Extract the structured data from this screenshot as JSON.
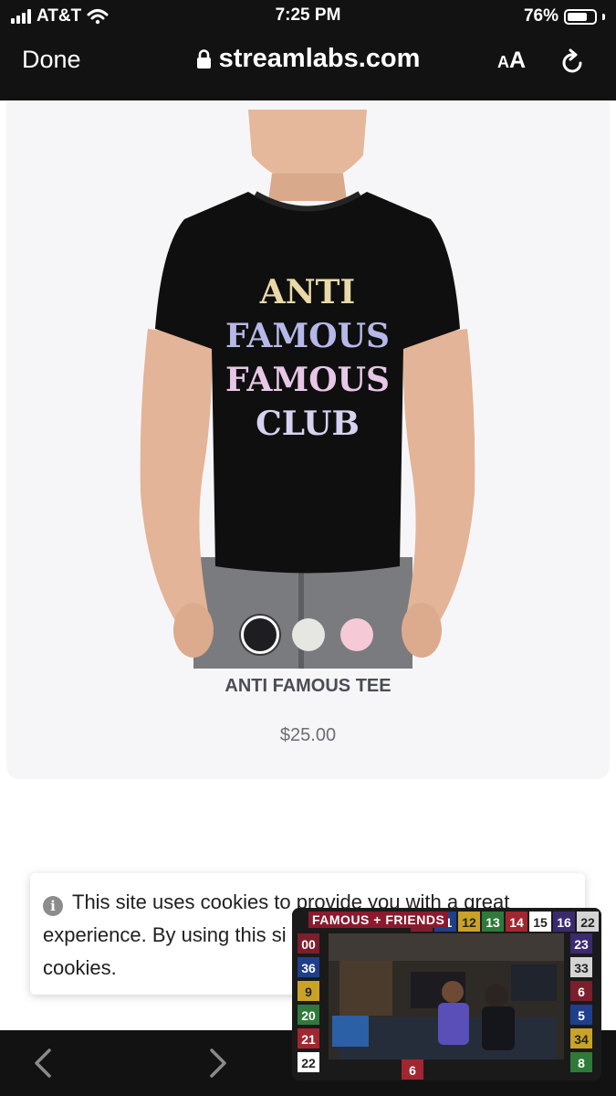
{
  "status_bar": {
    "carrier": "AT&T",
    "time": "7:25 PM",
    "battery": "76%",
    "battery_level": 0.76
  },
  "browser": {
    "done_label": "Done",
    "url": "streamlabs.com",
    "text_size_small": "A",
    "text_size_large": "A"
  },
  "product": {
    "shirt_text": [
      "ANTI",
      "FAMOUS",
      "FAMOUS",
      "CLUB"
    ],
    "title": "ANTI FAMOUS TEE",
    "price": "$25.00",
    "swatches": [
      {
        "color": "#1e1e22",
        "selected": true
      },
      {
        "color": "#e6e6e3",
        "selected": false
      },
      {
        "color": "#f6c9d6",
        "selected": false
      }
    ]
  },
  "cookie_banner": {
    "line1": "This site uses cookies to provide you with a great",
    "line2": "experience. By using this si",
    "line3": "cookies."
  },
  "pip_video": {
    "overlay_title": "FAMOUS + FRIENDS",
    "jersey_numbers": [
      "13",
      "11",
      "12",
      "13",
      "14",
      "15",
      "16",
      "22",
      "00",
      "36",
      "9",
      "20",
      "21",
      "22",
      "23",
      "33",
      "6",
      "5",
      "34",
      "8",
      "6"
    ]
  }
}
